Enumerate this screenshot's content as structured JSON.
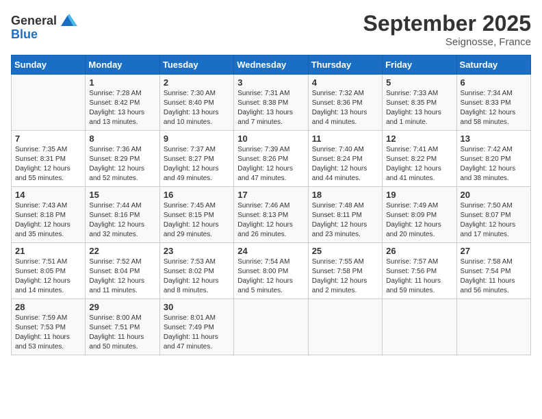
{
  "header": {
    "logo_general": "General",
    "logo_blue": "Blue",
    "month": "September 2025",
    "location": "Seignosse, France"
  },
  "days_of_week": [
    "Sunday",
    "Monday",
    "Tuesday",
    "Wednesday",
    "Thursday",
    "Friday",
    "Saturday"
  ],
  "weeks": [
    [
      {
        "day": "",
        "content": ""
      },
      {
        "day": "1",
        "content": "Sunrise: 7:28 AM\nSunset: 8:42 PM\nDaylight: 13 hours\nand 13 minutes."
      },
      {
        "day": "2",
        "content": "Sunrise: 7:30 AM\nSunset: 8:40 PM\nDaylight: 13 hours\nand 10 minutes."
      },
      {
        "day": "3",
        "content": "Sunrise: 7:31 AM\nSunset: 8:38 PM\nDaylight: 13 hours\nand 7 minutes."
      },
      {
        "day": "4",
        "content": "Sunrise: 7:32 AM\nSunset: 8:36 PM\nDaylight: 13 hours\nand 4 minutes."
      },
      {
        "day": "5",
        "content": "Sunrise: 7:33 AM\nSunset: 8:35 PM\nDaylight: 13 hours\nand 1 minute."
      },
      {
        "day": "6",
        "content": "Sunrise: 7:34 AM\nSunset: 8:33 PM\nDaylight: 12 hours\nand 58 minutes."
      }
    ],
    [
      {
        "day": "7",
        "content": "Sunrise: 7:35 AM\nSunset: 8:31 PM\nDaylight: 12 hours\nand 55 minutes."
      },
      {
        "day": "8",
        "content": "Sunrise: 7:36 AM\nSunset: 8:29 PM\nDaylight: 12 hours\nand 52 minutes."
      },
      {
        "day": "9",
        "content": "Sunrise: 7:37 AM\nSunset: 8:27 PM\nDaylight: 12 hours\nand 49 minutes."
      },
      {
        "day": "10",
        "content": "Sunrise: 7:39 AM\nSunset: 8:26 PM\nDaylight: 12 hours\nand 47 minutes."
      },
      {
        "day": "11",
        "content": "Sunrise: 7:40 AM\nSunset: 8:24 PM\nDaylight: 12 hours\nand 44 minutes."
      },
      {
        "day": "12",
        "content": "Sunrise: 7:41 AM\nSunset: 8:22 PM\nDaylight: 12 hours\nand 41 minutes."
      },
      {
        "day": "13",
        "content": "Sunrise: 7:42 AM\nSunset: 8:20 PM\nDaylight: 12 hours\nand 38 minutes."
      }
    ],
    [
      {
        "day": "14",
        "content": "Sunrise: 7:43 AM\nSunset: 8:18 PM\nDaylight: 12 hours\nand 35 minutes."
      },
      {
        "day": "15",
        "content": "Sunrise: 7:44 AM\nSunset: 8:16 PM\nDaylight: 12 hours\nand 32 minutes."
      },
      {
        "day": "16",
        "content": "Sunrise: 7:45 AM\nSunset: 8:15 PM\nDaylight: 12 hours\nand 29 minutes."
      },
      {
        "day": "17",
        "content": "Sunrise: 7:46 AM\nSunset: 8:13 PM\nDaylight: 12 hours\nand 26 minutes."
      },
      {
        "day": "18",
        "content": "Sunrise: 7:48 AM\nSunset: 8:11 PM\nDaylight: 12 hours\nand 23 minutes."
      },
      {
        "day": "19",
        "content": "Sunrise: 7:49 AM\nSunset: 8:09 PM\nDaylight: 12 hours\nand 20 minutes."
      },
      {
        "day": "20",
        "content": "Sunrise: 7:50 AM\nSunset: 8:07 PM\nDaylight: 12 hours\nand 17 minutes."
      }
    ],
    [
      {
        "day": "21",
        "content": "Sunrise: 7:51 AM\nSunset: 8:05 PM\nDaylight: 12 hours\nand 14 minutes."
      },
      {
        "day": "22",
        "content": "Sunrise: 7:52 AM\nSunset: 8:04 PM\nDaylight: 12 hours\nand 11 minutes."
      },
      {
        "day": "23",
        "content": "Sunrise: 7:53 AM\nSunset: 8:02 PM\nDaylight: 12 hours\nand 8 minutes."
      },
      {
        "day": "24",
        "content": "Sunrise: 7:54 AM\nSunset: 8:00 PM\nDaylight: 12 hours\nand 5 minutes."
      },
      {
        "day": "25",
        "content": "Sunrise: 7:55 AM\nSunset: 7:58 PM\nDaylight: 12 hours\nand 2 minutes."
      },
      {
        "day": "26",
        "content": "Sunrise: 7:57 AM\nSunset: 7:56 PM\nDaylight: 11 hours\nand 59 minutes."
      },
      {
        "day": "27",
        "content": "Sunrise: 7:58 AM\nSunset: 7:54 PM\nDaylight: 11 hours\nand 56 minutes."
      }
    ],
    [
      {
        "day": "28",
        "content": "Sunrise: 7:59 AM\nSunset: 7:53 PM\nDaylight: 11 hours\nand 53 minutes."
      },
      {
        "day": "29",
        "content": "Sunrise: 8:00 AM\nSunset: 7:51 PM\nDaylight: 11 hours\nand 50 minutes."
      },
      {
        "day": "30",
        "content": "Sunrise: 8:01 AM\nSunset: 7:49 PM\nDaylight: 11 hours\nand 47 minutes."
      },
      {
        "day": "",
        "content": ""
      },
      {
        "day": "",
        "content": ""
      },
      {
        "day": "",
        "content": ""
      },
      {
        "day": "",
        "content": ""
      }
    ]
  ]
}
